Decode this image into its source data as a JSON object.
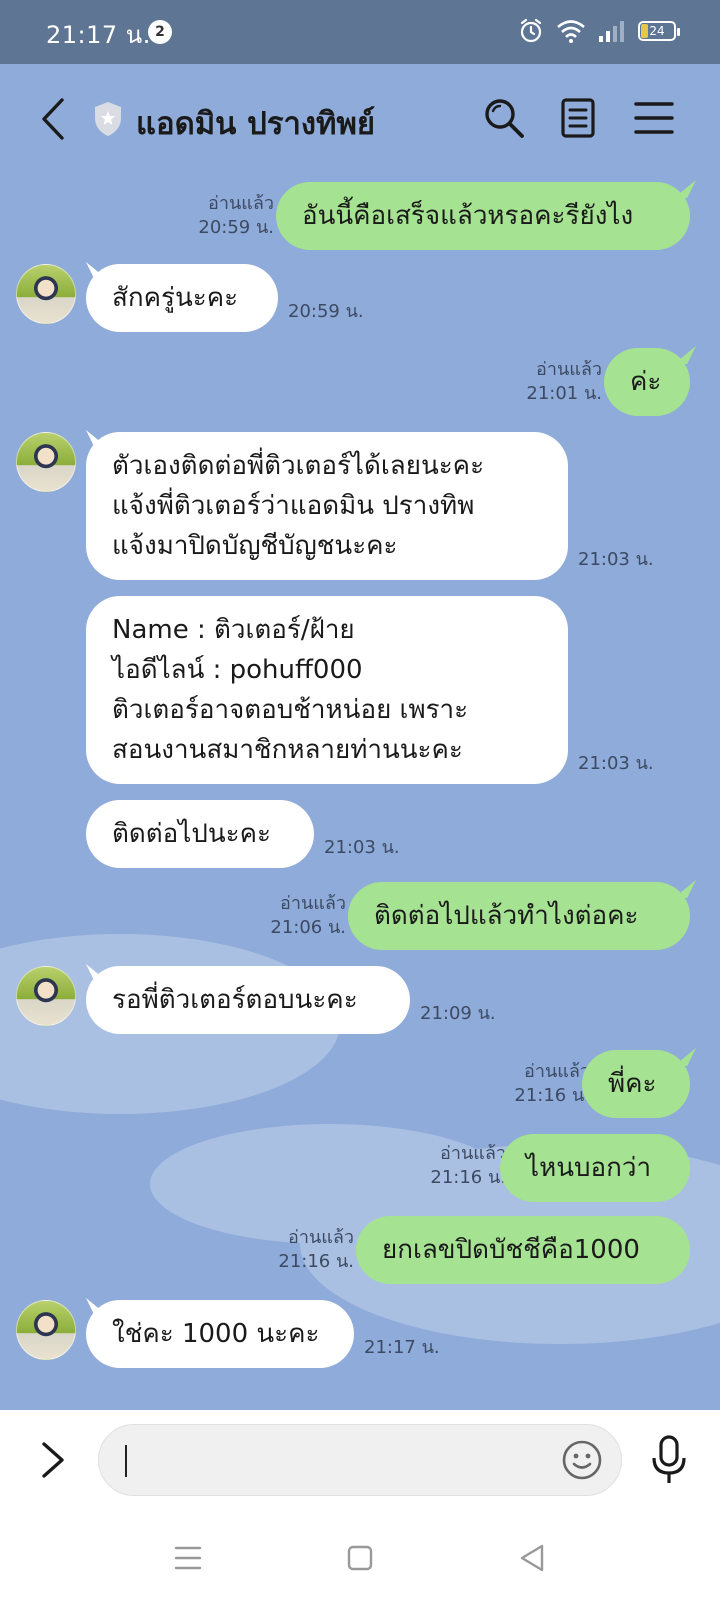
{
  "status_bar": {
    "time": "21:17 น.",
    "notification_count": "2",
    "battery": "24",
    "icons": [
      "alarm-icon",
      "wifi-icon",
      "signal-icon",
      "battery-icon"
    ]
  },
  "header": {
    "title": "แอดมิน ปรางทิพย์",
    "icons": [
      "back-icon",
      "shield-icon",
      "search-icon",
      "notes-icon",
      "menu-icon"
    ]
  },
  "messages": [
    {
      "dir": "out",
      "text": "อันนี้คือเสร็จแล้วหรอคะรียังไง",
      "read": "อ่านแล้ว",
      "time": "20:59 น."
    },
    {
      "dir": "in",
      "text": "สักครู่นะคะ",
      "time": "20:59 น."
    },
    {
      "dir": "out",
      "text": "ค่ะ",
      "read": "อ่านแล้ว",
      "time": "21:01 น."
    },
    {
      "dir": "in",
      "lines": [
        "ตัวเองติดต่อพี่ติวเตอร์ได้เลยนะคะ",
        "แจ้งพี่ติวเตอร์ว่าแอดมิน ปรางทิพ",
        "แจ้งมาปิดบัญชีบัญชนะคะ"
      ],
      "time": "21:03 น."
    },
    {
      "dir": "in",
      "lines": [
        "Name : ติวเตอร์/ฝ้าย",
        "ไอดีไลน์  :  pohuff000",
        "ติวเตอร์อาจตอบช้าหน่อย เพราะ",
        "สอนงานสมาชิกหลายท่านนะคะ"
      ],
      "time": "21:03 น."
    },
    {
      "dir": "in",
      "text": "ติดต่อไปนะคะ",
      "time": "21:03 น."
    },
    {
      "dir": "out",
      "text": "ติดต่อไปแล้วทำไงต่อคะ",
      "read": "อ่านแล้ว",
      "time": "21:06 น."
    },
    {
      "dir": "in",
      "text": "รอพี่ติวเตอร์ตอบนะคะ",
      "time": "21:09 น."
    },
    {
      "dir": "out",
      "text": "พี่คะ",
      "read": "อ่านแล้ว",
      "time": "21:16 น."
    },
    {
      "dir": "out",
      "text": "ไหนบอกว่า",
      "read": "อ่านแล้ว",
      "time": "21:16 น."
    },
    {
      "dir": "out",
      "text": "ยกเลขปิดบัชชีคือ1000",
      "read": "อ่านแล้ว",
      "time": "21:16 น."
    },
    {
      "dir": "in",
      "text": "ใช่คะ 1000 นะคะ",
      "time": "21:17 น."
    }
  ],
  "input_bar": {
    "value": "",
    "icons": [
      "chevron-right-icon",
      "emoji-icon",
      "microphone-icon"
    ]
  },
  "nav_bar": {
    "icons": [
      "recent-apps-icon",
      "home-icon",
      "back-nav-icon"
    ]
  },
  "colors": {
    "chat_background": "#8eabd9",
    "status_bar": "#5f7594",
    "outgoing_bubble": "#a5e291",
    "incoming_bubble": "#ffffff"
  }
}
